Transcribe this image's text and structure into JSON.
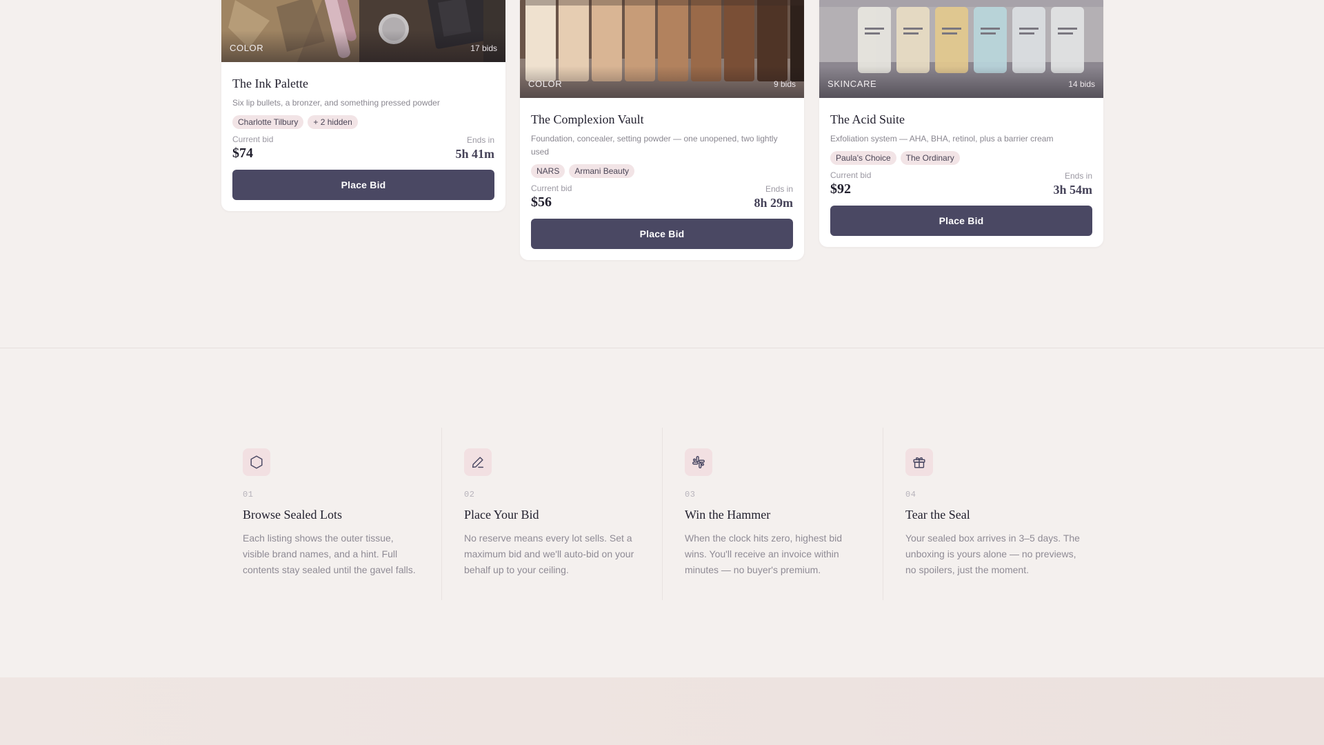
{
  "lots": [
    {
      "category": "COLOR",
      "bids": "17 bids",
      "title": "The Ink Palette",
      "description": "Six lip bullets, a bronzer, and something pressed powder",
      "tags": [
        "Charlotte Tilbury",
        "+ 2 hidden"
      ],
      "current_bid_label": "Current bid",
      "current_bid": "$74",
      "ends_label": "Ends in",
      "ends_in": "5h 41m",
      "button": "Place Bid"
    },
    {
      "category": "COLOR",
      "bids": "9 bids",
      "title": "The Complexion Vault",
      "description": "Foundation, concealer, setting powder — one unopened, two lightly used",
      "tags": [
        "NARS",
        "Armani Beauty"
      ],
      "current_bid_label": "Current bid",
      "current_bid": "$56",
      "ends_label": "Ends in",
      "ends_in": "8h 29m",
      "button": "Place Bid"
    },
    {
      "category": "SKINCARE",
      "bids": "14 bids",
      "title": "The Acid Suite",
      "description": "Exfoliation system — AHA, BHA, retinol, plus a barrier cream",
      "tags": [
        "Paula's Choice",
        "The Ordinary"
      ],
      "current_bid_label": "Current bid",
      "current_bid": "$92",
      "ends_label": "Ends in",
      "ends_in": "3h 54m",
      "button": "Place Bid"
    }
  ],
  "steps": [
    {
      "icon": "hexagon-icon",
      "number": "01",
      "title": "Browse Sealed Lots",
      "text": "Each listing shows the outer tissue, visible brand names, and a hint. Full contents stay sealed until the gavel falls."
    },
    {
      "icon": "pen-icon",
      "number": "02",
      "title": "Place Your Bid",
      "text": "No reserve means every lot sells. Set a maximum bid and we'll auto-bid on your behalf up to your ceiling."
    },
    {
      "icon": "hash-icon",
      "number": "03",
      "title": "Win the Hammer",
      "text": "When the clock hits zero, highest bid wins. You'll receive an invoice within minutes — no buyer's premium."
    },
    {
      "icon": "gift-icon",
      "number": "04",
      "title": "Tear the Seal",
      "text": "Your sealed box arrives in 3–5 days. The unboxing is yours alone — no previews, no spoilers, just the moment."
    }
  ],
  "colors": {
    "accent": "#4a4863",
    "tag_bg": "#f2e4e6",
    "icon_bg": "#f2e0e2",
    "page_bg": "#f4f0ee"
  }
}
